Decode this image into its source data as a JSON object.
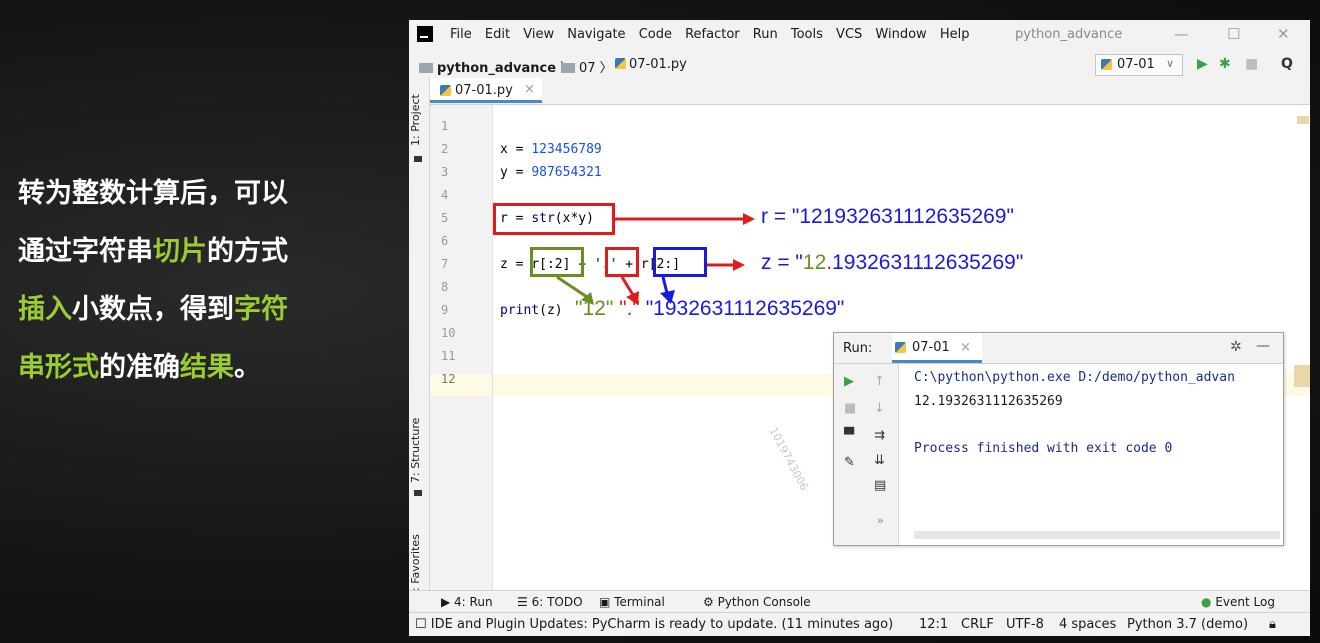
{
  "caption": {
    "l1a": "转为整数计算后，可以",
    "l2a": "通过字符串",
    "l2b": "切片",
    "l2c": "的方式",
    "l3a": "插入",
    "l3b": "小数点，得到",
    "l3c": "字符",
    "l4a": "串形式",
    "l4b": "的准确",
    "l4c": "结果",
    "l4d": "。",
    "highlight_color": "#9acd32"
  },
  "titlebar": {
    "menu": [
      "File",
      "Edit",
      "View",
      "Navigate",
      "Code",
      "Refactor",
      "Run",
      "Tools",
      "VCS",
      "Window",
      "Help"
    ],
    "project_name": "python_advance",
    "minimize": "—",
    "maximize": "☐",
    "close": "✕"
  },
  "navbar": {
    "crumb1": "python_advance",
    "crumb2": "07",
    "crumb3": "07-01.py",
    "run_config": "07-01",
    "run_icon": "▶",
    "debug_icon": "✱",
    "stop_icon": "■",
    "search_icon": "Q"
  },
  "side_tabs": {
    "project": "1: Project",
    "structure": "7: Structure",
    "favorites": "2: Favorites"
  },
  "editor": {
    "tab_label": "07-01.py",
    "tab_close": "×",
    "line_numbers": [
      "1",
      "2",
      "3",
      "4",
      "5",
      "6",
      "7",
      "8",
      "9",
      "10",
      "11",
      "12"
    ],
    "l2a": "x = ",
    "l2b": "123456789",
    "l3a": "y = ",
    "l3b": "987654321",
    "l5a": "r = ",
    "l5b": "str",
    "l5c": "(x*y)",
    "l7a": "z = ",
    "l7b": "r[:2]",
    "l7c": " + ",
    "l7d": "'.'",
    "l7e": " + ",
    "l7f": "r[2:]",
    "l9a": "print",
    "l9b": "(z)",
    "watermark": "1019743006"
  },
  "annotations": {
    "r_value": "r = \"1219326311126352​69\"",
    "z_prefix": "z = \"",
    "z_olive": "12",
    "z_red": ".",
    "z_blue": "193263111263526​9\"",
    "p_olive": "\"12\"",
    "p_red": "\".\"",
    "p_blue": "\"193263111263526​9\""
  },
  "run_panel": {
    "title": "Run:",
    "tab_label": "07-01",
    "tab_close": "×",
    "gear": "✲",
    "minimize": "—",
    "cmd": "C:\\python\\python.exe D:/demo/python_advan",
    "output": "12.1932631112635269",
    "exit": "Process finished with exit code 0"
  },
  "bottom_tabs": {
    "run": "4: Run",
    "todo": "6: TODO",
    "terminal": "Terminal",
    "console": "Python Console",
    "event_log": "Event Log"
  },
  "status": {
    "message": "IDE and Plugin Updates: PyCharm is ready to update. (11 minutes ago)",
    "position": "12:1",
    "line_sep": "CRLF",
    "encoding": "UTF-8",
    "indent": "4 spaces",
    "interpreter": "Python 3.7 (demo)"
  }
}
